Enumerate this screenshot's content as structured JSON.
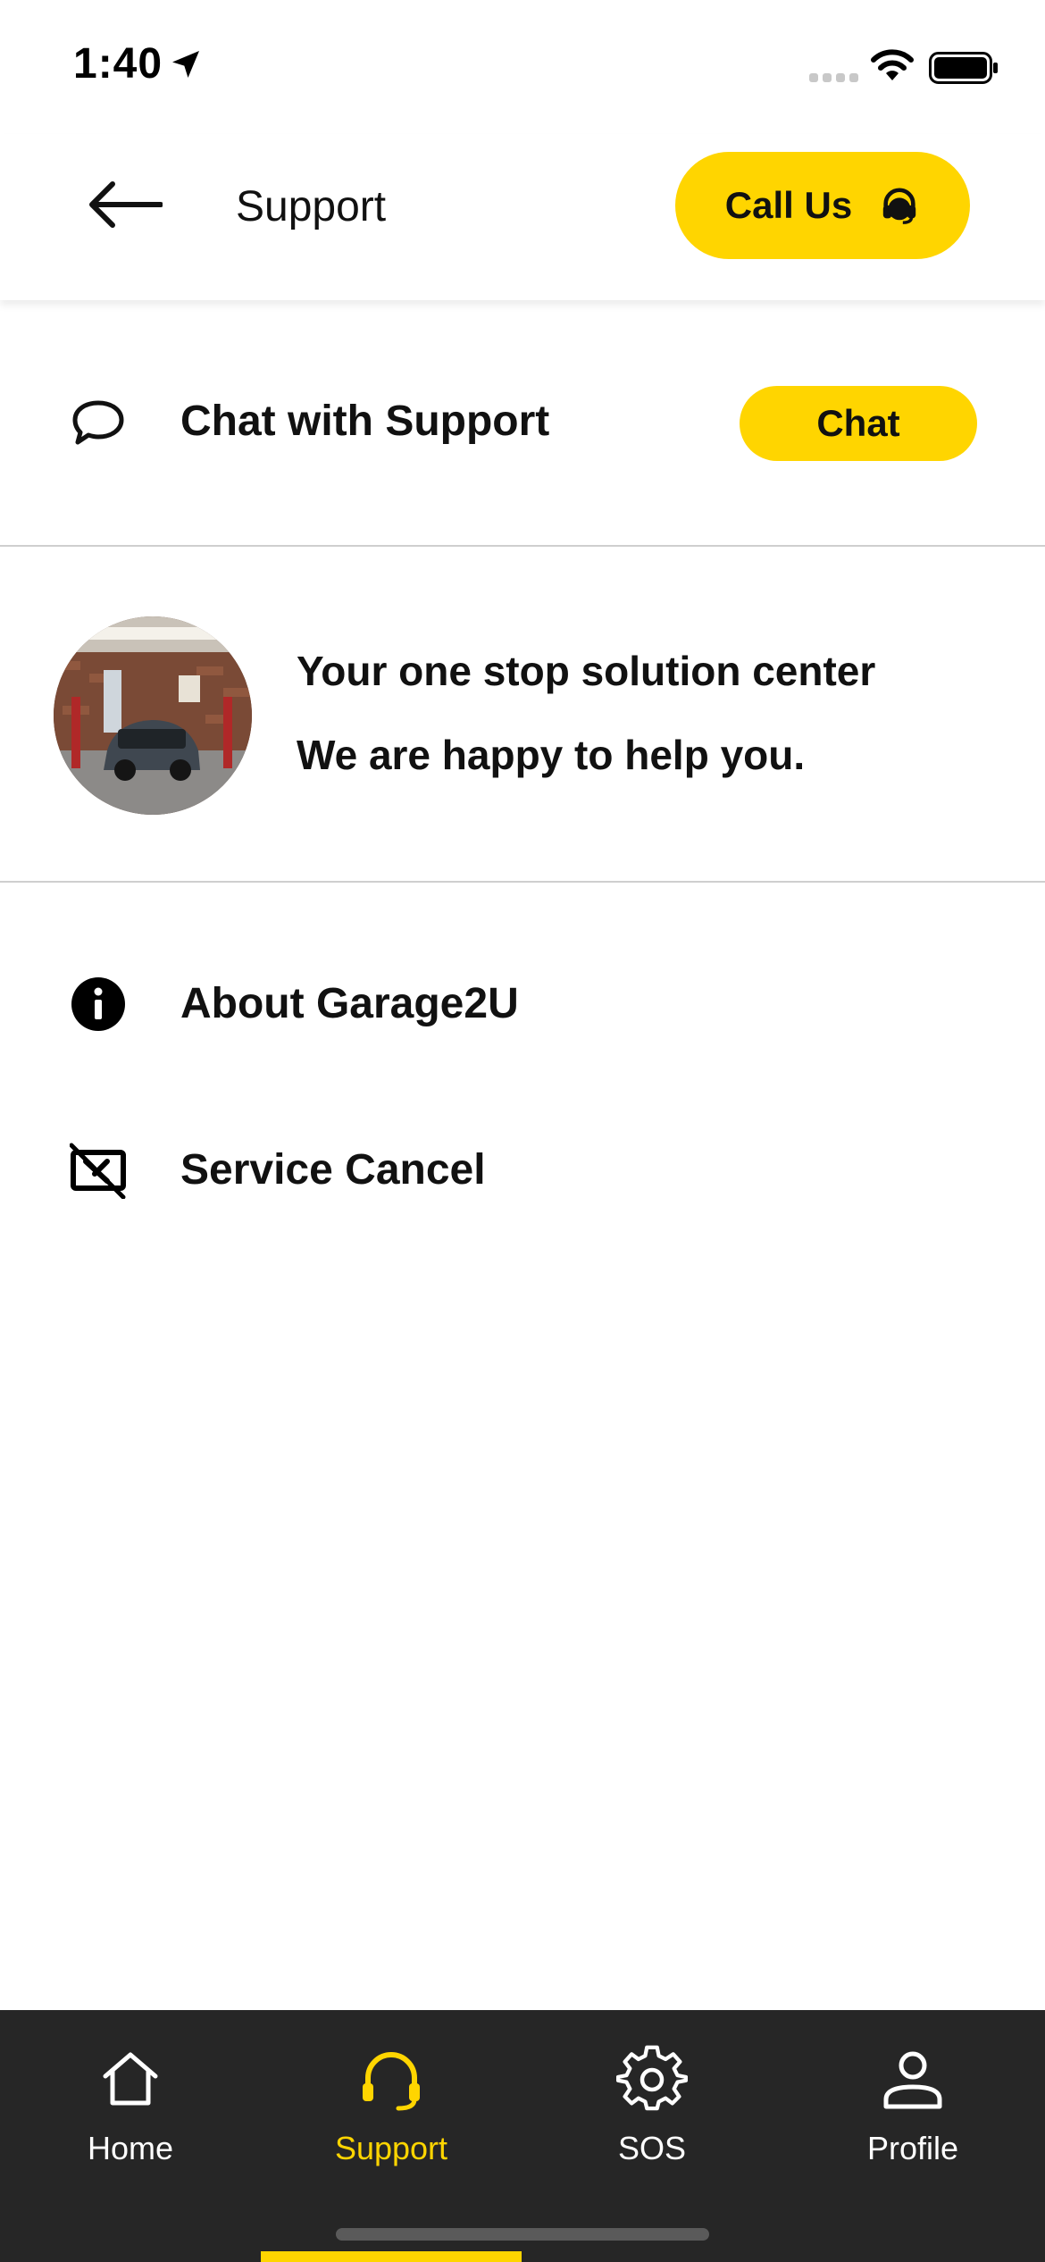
{
  "status_bar": {
    "time": "1:40"
  },
  "header": {
    "title": "Support",
    "call_label": "Call Us"
  },
  "chat": {
    "title": "Chat with Support",
    "button_label": "Chat"
  },
  "banner": {
    "line1": "Your one stop solution center",
    "line2": "We are happy to help you."
  },
  "menu": [
    {
      "label": "About Garage2U",
      "icon": "info-icon"
    },
    {
      "label": "Service Cancel",
      "icon": "cancel-icon"
    }
  ],
  "nav": {
    "items": [
      {
        "label": "Home",
        "icon": "home-icon"
      },
      {
        "label": "Support",
        "icon": "headset-icon",
        "active": true
      },
      {
        "label": "SOS",
        "icon": "gear-icon"
      },
      {
        "label": "Profile",
        "icon": "user-icon"
      }
    ]
  },
  "colors": {
    "accent": "#FFD500",
    "nav_bg": "#262626",
    "divider": "#cfcfcf"
  }
}
